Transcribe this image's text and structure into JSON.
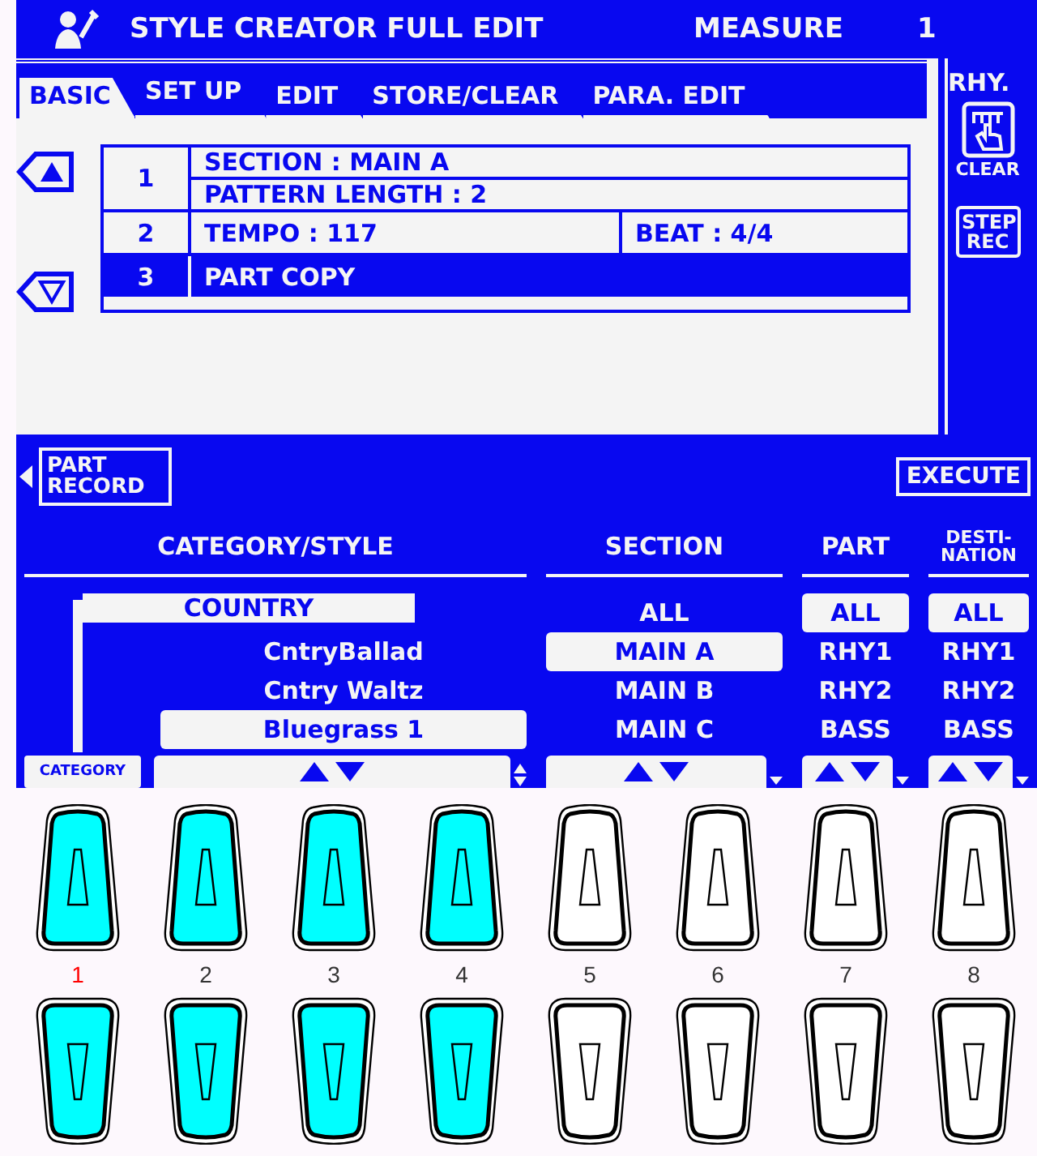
{
  "header": {
    "title": "STYLE CREATOR FULL EDIT",
    "measure_label": "MEASURE",
    "measure_value": "1"
  },
  "tabs": [
    {
      "label": "BASIC",
      "selected": true
    },
    {
      "label": "SET UP",
      "selected": false
    },
    {
      "label": "EDIT",
      "selected": false
    },
    {
      "label": "STORE/CLEAR",
      "selected": false
    },
    {
      "label": "PARA. EDIT",
      "selected": false
    }
  ],
  "side": {
    "label": "RHY.",
    "clear_button": "CLEAR",
    "step_rec_button": "STEP REC"
  },
  "rows": [
    {
      "number": "1",
      "kind": "stacked",
      "fields": [
        "SECTION : MAIN A",
        "PATTERN LENGTH : 2"
      ],
      "selected": false
    },
    {
      "number": "2",
      "kind": "split",
      "fields": [
        "TEMPO : 117",
        "BEAT : 4/4"
      ],
      "selected": false
    },
    {
      "number": "3",
      "kind": "single",
      "fields": [
        "PART COPY"
      ],
      "selected": true
    }
  ],
  "part_record_button": "PART RECORD",
  "execute_button": "EXECUTE",
  "columns": [
    {
      "kind": "style",
      "heading": "CATEGORY/STYLE",
      "category": "COUNTRY",
      "category_button": "CATEGORY",
      "items": [
        {
          "label": "CntryBallad",
          "selected": false
        },
        {
          "label": "Cntry Waltz",
          "selected": false
        },
        {
          "label": "Bluegrass 1",
          "selected": true
        }
      ]
    },
    {
      "kind": "list",
      "heading": "SECTION",
      "items": [
        {
          "label": "ALL",
          "selected": false
        },
        {
          "label": "MAIN A",
          "selected": true
        },
        {
          "label": "MAIN B",
          "selected": false
        },
        {
          "label": "MAIN C",
          "selected": false
        }
      ]
    },
    {
      "kind": "list",
      "heading": "PART",
      "items": [
        {
          "label": "ALL",
          "selected": true
        },
        {
          "label": "RHY1",
          "selected": false
        },
        {
          "label": "RHY2",
          "selected": false
        },
        {
          "label": "BASS",
          "selected": false
        }
      ]
    },
    {
      "kind": "list",
      "heading": "DESTI-NATION",
      "items": [
        {
          "label": "ALL",
          "selected": true
        },
        {
          "label": "RHY1",
          "selected": false
        },
        {
          "label": "RHY2",
          "selected": false
        },
        {
          "label": "BASS",
          "selected": false
        }
      ]
    }
  ],
  "panel_buttons": [
    {
      "number": "1",
      "lit": true,
      "selected": true
    },
    {
      "number": "2",
      "lit": true,
      "selected": false
    },
    {
      "number": "3",
      "lit": true,
      "selected": false
    },
    {
      "number": "4",
      "lit": true,
      "selected": false
    },
    {
      "number": "5",
      "lit": false,
      "selected": false
    },
    {
      "number": "6",
      "lit": false,
      "selected": false
    },
    {
      "number": "7",
      "lit": false,
      "selected": false
    },
    {
      "number": "8",
      "lit": false,
      "selected": false
    }
  ]
}
